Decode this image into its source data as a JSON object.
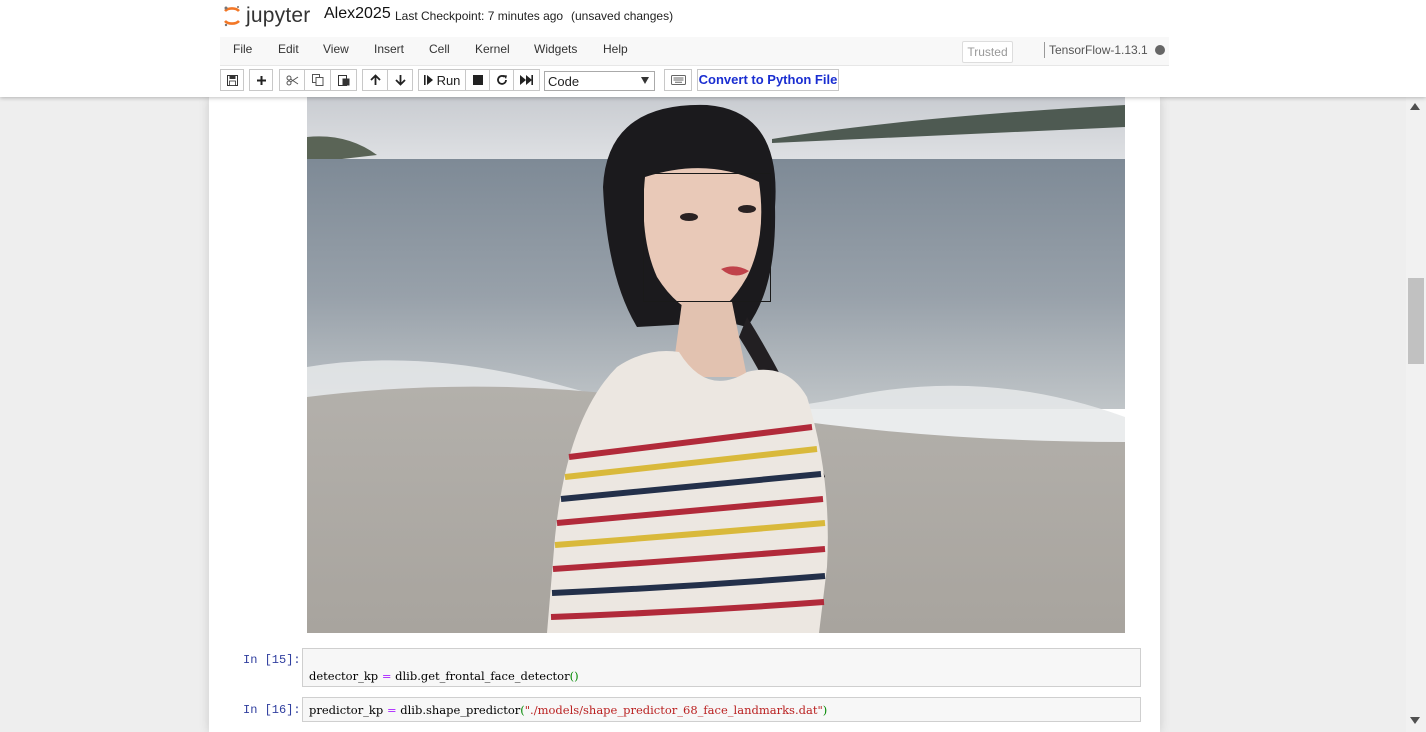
{
  "header": {
    "logo_text": "jupyter",
    "notebook_name": "Alex2025",
    "checkpoint": "Last Checkpoint: 7 minutes ago",
    "save_status": "(unsaved changes)"
  },
  "menu": {
    "items": [
      "File",
      "Edit",
      "View",
      "Insert",
      "Cell",
      "Kernel",
      "Widgets",
      "Help"
    ],
    "trusted_label": "Trusted",
    "kernel_name": "TensorFlow-1.13.1"
  },
  "toolbar": {
    "run_label": "Run",
    "cell_type": "Code",
    "convert_label": "Convert to Python File",
    "icons": [
      "save-icon",
      "plus-icon",
      "cut-icon",
      "copy-icon",
      "paste-icon",
      "arrow-up-icon",
      "arrow-down-icon",
      "step-forward-icon",
      "stop-icon",
      "restart-icon",
      "fast-forward-icon",
      "keyboard-icon"
    ]
  },
  "output": {
    "image_description_icon": "photo-output-icon"
  },
  "cells": [
    {
      "prompt": "In  [15]:",
      "code_tokens": [
        "detector_kp ",
        "=",
        " dlib.get_frontal_face_detector",
        "()"
      ]
    },
    {
      "prompt": "In  [16]:",
      "code_tokens": [
        "predictor_kp ",
        "=",
        " dlib.shape_predictor",
        "(",
        "\"./models/shape_predictor_68_face_landmarks.dat\"",
        ")"
      ]
    }
  ],
  "colors": {
    "accent_link": "#1a2ed1",
    "prompt": "#303f9f",
    "string": "#ba2121",
    "operator": "#aa22ff",
    "paren": "#008800",
    "jupyter_orange": "#f37726"
  }
}
